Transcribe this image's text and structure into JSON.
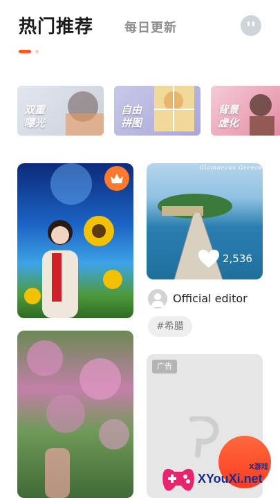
{
  "header": {
    "tabs": [
      {
        "label": "热门推荐",
        "active": true
      },
      {
        "label": "每日更新",
        "active": false
      }
    ],
    "profile_icon": "face-icon",
    "accent_color": "#ff5a2a"
  },
  "features": [
    {
      "label": "双重曝光"
    },
    {
      "label": "自由拼图"
    },
    {
      "label": "背景虚化"
    }
  ],
  "feed": {
    "left": [
      {
        "type": "photo",
        "badge_icon": "crown-icon"
      },
      {
        "type": "photo"
      }
    ],
    "right": [
      {
        "type": "photo",
        "caption": "Glamorous Greece",
        "likes": "2,536",
        "author": "Official editor",
        "tag": "#希腊"
      },
      {
        "type": "ad",
        "badge": "广告"
      }
    ]
  },
  "fab_icon": "plus-icon",
  "watermark": {
    "brand": "XYouXi.net",
    "sub": "X游戏"
  }
}
